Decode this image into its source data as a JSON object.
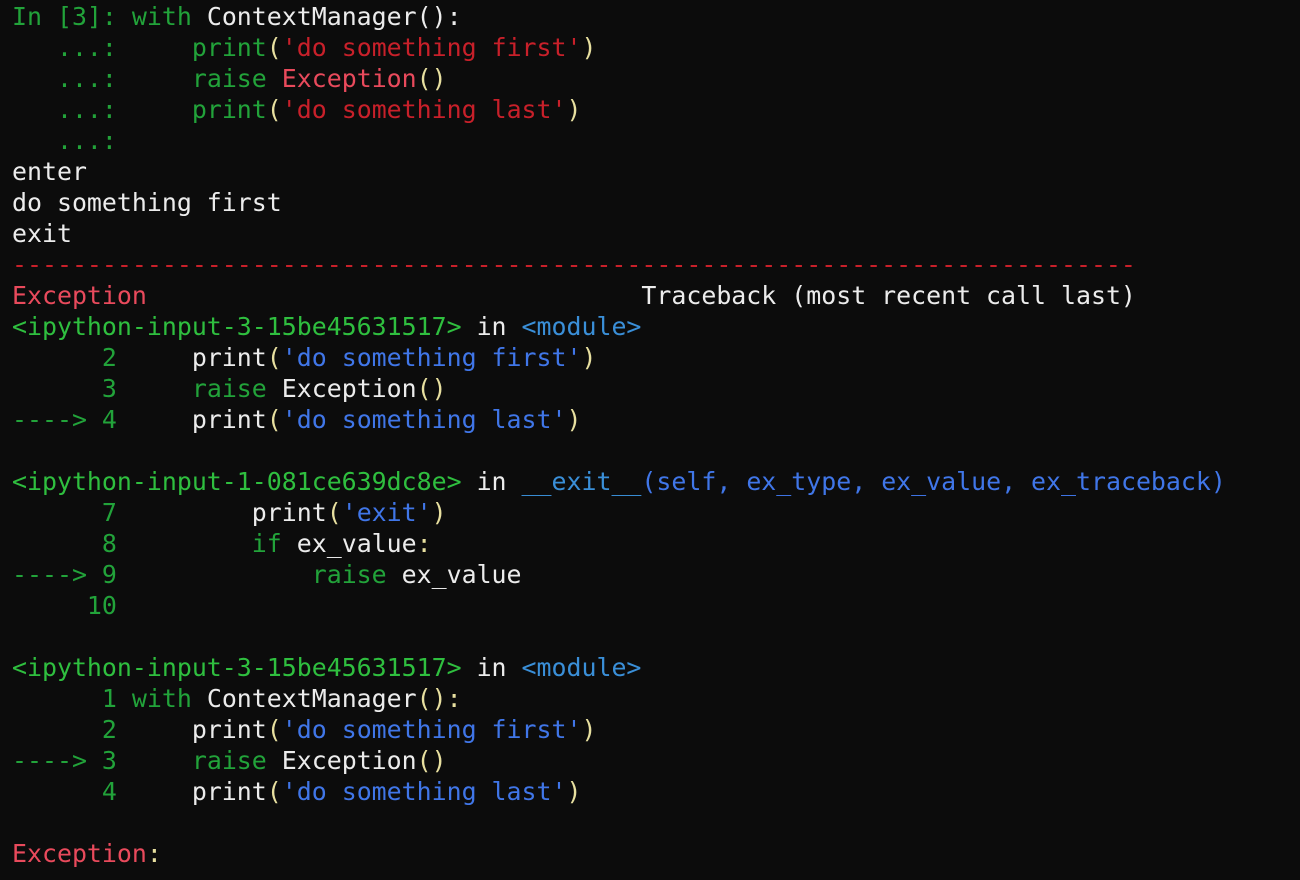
{
  "colors": {
    "background": "#0c0c0c",
    "text": "#ececec",
    "prompt_green": "#22a33a",
    "string_red": "#c8202a",
    "exception_pink": "#e94a5c",
    "paren_yellow": "#e8e0a0",
    "string_blue": "#4076e8",
    "module_cyan": "#3a8fd8"
  },
  "lines": [
    [
      {
        "t": "In [3]: ",
        "c": "green"
      },
      {
        "t": "with",
        "c": "green"
      },
      {
        "t": " ContextManager():",
        "c": "white"
      }
    ],
    [
      {
        "t": "   ...: ",
        "c": "green"
      },
      {
        "t": "    ",
        "c": "white"
      },
      {
        "t": "print",
        "c": "green"
      },
      {
        "t": "(",
        "c": "yellow"
      },
      {
        "t": "'do something first'",
        "c": "red"
      },
      {
        "t": ")",
        "c": "yellow"
      }
    ],
    [
      {
        "t": "   ...: ",
        "c": "green"
      },
      {
        "t": "    ",
        "c": "white"
      },
      {
        "t": "raise",
        "c": "green"
      },
      {
        "t": " ",
        "c": "white"
      },
      {
        "t": "Exception",
        "c": "pink"
      },
      {
        "t": "()",
        "c": "yellow"
      }
    ],
    [
      {
        "t": "   ...: ",
        "c": "green"
      },
      {
        "t": "    ",
        "c": "white"
      },
      {
        "t": "print",
        "c": "green"
      },
      {
        "t": "(",
        "c": "yellow"
      },
      {
        "t": "'do something last'",
        "c": "red"
      },
      {
        "t": ")",
        "c": "yellow"
      }
    ],
    [
      {
        "t": "   ...:",
        "c": "green"
      }
    ],
    [
      {
        "t": "enter",
        "c": "white"
      }
    ],
    [
      {
        "t": "do something first",
        "c": "white"
      }
    ],
    [
      {
        "t": "exit",
        "c": "white"
      }
    ],
    [
      {
        "t": "---------------------------------------------------------------------------",
        "c": "red"
      }
    ],
    [
      {
        "t": "Exception",
        "c": "pink"
      },
      {
        "t": "                                 Traceback (most recent call last)",
        "c": "white"
      }
    ],
    [
      {
        "t": "<ipython-input-3-15be45631517>",
        "c": "lgreen"
      },
      {
        "t": " in ",
        "c": "white"
      },
      {
        "t": "<module>",
        "c": "cyan"
      }
    ],
    [
      {
        "t": "      2 ",
        "c": "green"
      },
      {
        "t": "    print",
        "c": "white"
      },
      {
        "t": "(",
        "c": "yellow"
      },
      {
        "t": "'do something first'",
        "c": "blue"
      },
      {
        "t": ")",
        "c": "yellow"
      }
    ],
    [
      {
        "t": "      3 ",
        "c": "green"
      },
      {
        "t": "    ",
        "c": "white"
      },
      {
        "t": "raise",
        "c": "green"
      },
      {
        "t": " Exception",
        "c": "white"
      },
      {
        "t": "()",
        "c": "yellow"
      }
    ],
    [
      {
        "t": "----> 4 ",
        "c": "green"
      },
      {
        "t": "    print",
        "c": "white"
      },
      {
        "t": "(",
        "c": "yellow"
      },
      {
        "t": "'do something last'",
        "c": "blue"
      },
      {
        "t": ")",
        "c": "yellow"
      }
    ],
    [],
    [
      {
        "t": "<ipython-input-1-081ce639dc8e>",
        "c": "lgreen"
      },
      {
        "t": " in ",
        "c": "white"
      },
      {
        "t": "__exit__",
        "c": "cyan"
      },
      {
        "t": "(self, ex_type, ex_value, ex_traceback)",
        "c": "blue"
      }
    ],
    [
      {
        "t": "      7 ",
        "c": "green"
      },
      {
        "t": "        print",
        "c": "white"
      },
      {
        "t": "(",
        "c": "yellow"
      },
      {
        "t": "'exit'",
        "c": "blue"
      },
      {
        "t": ")",
        "c": "yellow"
      }
    ],
    [
      {
        "t": "      8 ",
        "c": "green"
      },
      {
        "t": "        ",
        "c": "white"
      },
      {
        "t": "if",
        "c": "green"
      },
      {
        "t": " ex_value",
        "c": "white"
      },
      {
        "t": ":",
        "c": "yellow"
      }
    ],
    [
      {
        "t": "----> 9 ",
        "c": "green"
      },
      {
        "t": "            ",
        "c": "white"
      },
      {
        "t": "raise",
        "c": "green"
      },
      {
        "t": " ex_value",
        "c": "white"
      }
    ],
    [
      {
        "t": "     10 ",
        "c": "green"
      }
    ],
    [],
    [
      {
        "t": "<ipython-input-3-15be45631517>",
        "c": "lgreen"
      },
      {
        "t": " in ",
        "c": "white"
      },
      {
        "t": "<module>",
        "c": "cyan"
      }
    ],
    [
      {
        "t": "      1 ",
        "c": "green"
      },
      {
        "t": "with",
        "c": "green"
      },
      {
        "t": " ContextManager",
        "c": "white"
      },
      {
        "t": "():",
        "c": "yellow"
      }
    ],
    [
      {
        "t": "      2 ",
        "c": "green"
      },
      {
        "t": "    print",
        "c": "white"
      },
      {
        "t": "(",
        "c": "yellow"
      },
      {
        "t": "'do something first'",
        "c": "blue"
      },
      {
        "t": ")",
        "c": "yellow"
      }
    ],
    [
      {
        "t": "----> 3 ",
        "c": "green"
      },
      {
        "t": "    ",
        "c": "white"
      },
      {
        "t": "raise",
        "c": "green"
      },
      {
        "t": " Exception",
        "c": "white"
      },
      {
        "t": "()",
        "c": "yellow"
      }
    ],
    [
      {
        "t": "      4 ",
        "c": "green"
      },
      {
        "t": "    print",
        "c": "white"
      },
      {
        "t": "(",
        "c": "yellow"
      },
      {
        "t": "'do something last'",
        "c": "blue"
      },
      {
        "t": ")",
        "c": "yellow"
      }
    ],
    [],
    [
      {
        "t": "Exception",
        "c": "pink"
      },
      {
        "t": ":",
        "c": "yellow"
      }
    ]
  ]
}
